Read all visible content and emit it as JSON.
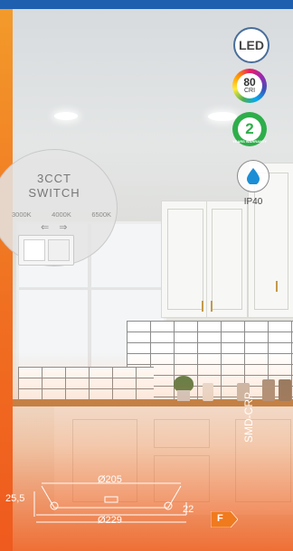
{
  "badges": {
    "led": "LED",
    "cri_value": "80",
    "cri_label": "CRI",
    "warranty_value": "2",
    "warranty_label": "YEARS WARRANTY",
    "ip_rating": "IP40"
  },
  "switch": {
    "title_line1": "3CCT",
    "title_line2": "SWITCH",
    "temps": [
      "3000K",
      "4000K",
      "6500K"
    ],
    "arrows": "⇐ ⇒"
  },
  "product": {
    "code": "SMD-CRP",
    "energy_class": "F"
  },
  "dimensions": {
    "cutout": "Ø205",
    "outer": "Ø229",
    "height": "25,5",
    "depth": "22"
  },
  "colors": {
    "top_bar": "#1f5fb0",
    "accent_orange": "#f06f21",
    "warranty_green": "#2eae4a",
    "ip_blue": "#1b8ed6"
  }
}
